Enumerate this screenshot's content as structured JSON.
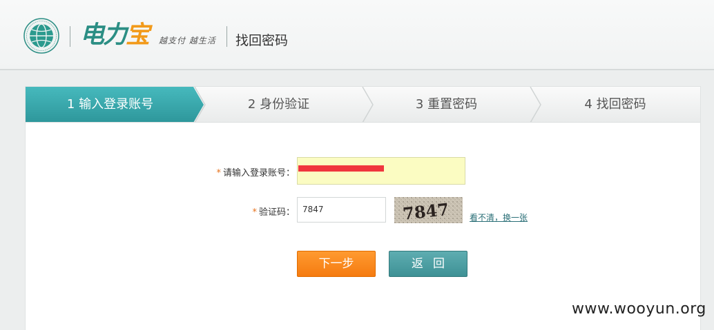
{
  "header": {
    "brand_part1": "电力",
    "brand_part2": "宝",
    "slogan": "越支付 越生活",
    "page_title": "找回密码"
  },
  "steps": [
    {
      "label": "1 输入登录账号",
      "active": true
    },
    {
      "label": "2 身份验证",
      "active": false
    },
    {
      "label": "3 重置密码",
      "active": false
    },
    {
      "label": "4 找回密码",
      "active": false
    }
  ],
  "form": {
    "required_mark": "*",
    "account_label": "请输入登录账号：",
    "account_value": "",
    "captcha_label": "验证码：",
    "captcha_value": "7847",
    "captcha_image_text": "7847",
    "refresh_link": "看不清，换一张",
    "next_button": "下一步",
    "back_button": "返回"
  },
  "watermark": "www.wooyun.org",
  "colors": {
    "accent_teal": "#3aa7ab",
    "brand_teal": "#2b8e84",
    "brand_orange": "#f29a1a",
    "next_orange": "#f58a1e",
    "input_yellow": "#fbfcc2"
  },
  "icons": {
    "logo": "state-grid-globe-icon"
  }
}
